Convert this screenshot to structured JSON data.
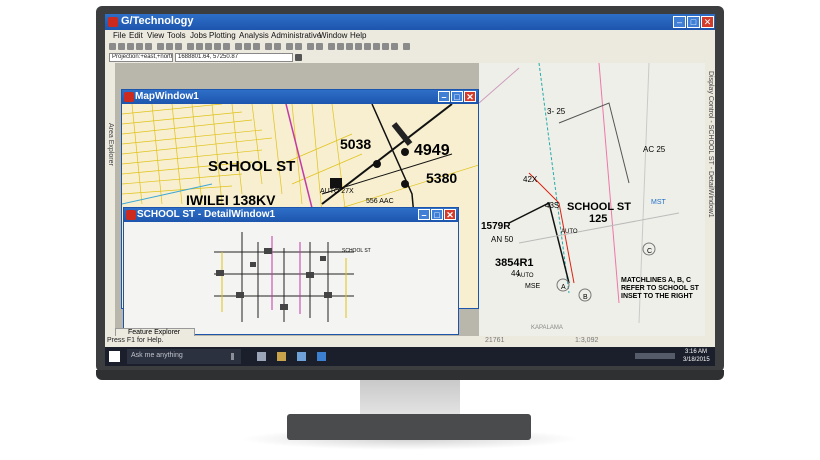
{
  "app": {
    "title": "G/Technology",
    "menu": [
      "File",
      "Edit",
      "View",
      "Tools",
      "Jobs",
      "Plotting",
      "Analysis",
      "Administrative",
      "Window",
      "Help"
    ],
    "projection": "Projection:+east,+north(ft)",
    "coordinates": "1688801.64, 57250.87"
  },
  "rails": {
    "left": "Area Explorer",
    "right": "Display Control - SCHOOL ST - DetailWindow1"
  },
  "map_window": {
    "title": "MapWindow1",
    "labels": {
      "school_st": "SCHOOL ST",
      "iwilei": "IWILEI 138KV",
      "n5038": "5038",
      "n4949": "4949",
      "n5380": "5380",
      "auto27x": "AUTO 27X",
      "n556": "556 AAC",
      "school_st_right": "SCHOOL ST",
      "n125": "125",
      "n1579r": "1579R",
      "an50": "AN 50",
      "n3854r1": "3854R1",
      "n44": "44",
      "mse": "MSE",
      "n43s": "43S",
      "n42x": "42X",
      "n3_25": "3- 25",
      "ac25": "AC 25",
      "mst": "MST",
      "ca": "A",
      "cb": "B",
      "cc": "C",
      "auto_a": "AUTO",
      "auto_b": "AUTO",
      "matchlines": "MATCHLINES A, B, C\nREFER TO SCHOOL ST\nINSET TO THE RIGHT",
      "kapalama": "KAPALAMA"
    }
  },
  "detail_window": {
    "title": "SCHOOL ST - DetailWindow1",
    "label": "SCHOOL ST"
  },
  "feature_explorer": "Feature Explorer",
  "status": {
    "help": "Press F1 for Help.",
    "cell1": "21761",
    "cell2": "1:3,092"
  },
  "taskbar": {
    "search_placeholder": "Ask me anything",
    "time": "3:16 AM",
    "date": "3/18/2015"
  },
  "colors": {
    "titlebar": "#1d55ad",
    "map_bg": "#f7efcf",
    "street_yellow": "#e0c21a",
    "close_red": "#d33b2a"
  }
}
